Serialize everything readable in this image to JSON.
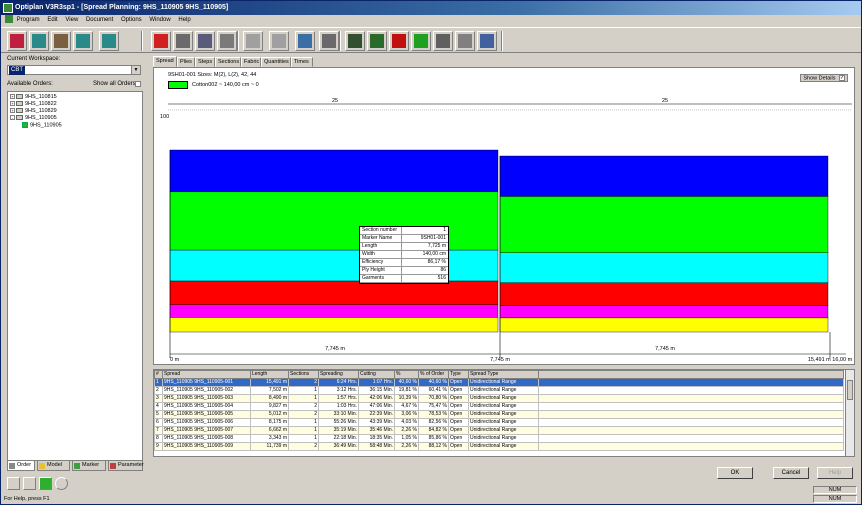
{
  "window": {
    "title": "Optiplan V3R3sp1 - [Spread Planning: 9HS_110905 9HS_110905]"
  },
  "menu": [
    "Program",
    "Edit",
    "View",
    "Document",
    "Options",
    "Window",
    "Help"
  ],
  "toolbar_icons": [
    "planning-icon",
    "marker-icon",
    "order-icon",
    "spread-icon",
    "cut-icon",
    "save-icon",
    "print-preview-icon",
    "edit-icon",
    "columns-icon",
    "move-icon",
    "hand-icon",
    "report-icon",
    "mail-icon",
    "marker-tool-icon",
    "marker-tool-2-icon",
    "trash-red-icon",
    "trash-green-icon",
    "trash-gray-icon",
    "print-icon",
    "zoom-icon"
  ],
  "left": {
    "workspace_label": "Current Workspace:",
    "workspace_value": "CBT",
    "orders_label": "Available Orders:",
    "show_all_label": "Show all Orders",
    "tree": [
      {
        "label": "9HS_110815",
        "level": 0,
        "expander": "+"
      },
      {
        "label": "9HS_110822",
        "level": 0,
        "expander": "+"
      },
      {
        "label": "9HS_110829",
        "level": 0,
        "expander": "+"
      },
      {
        "label": "9HS_110905",
        "level": 0,
        "expander": "-"
      },
      {
        "label": "9HS_110905",
        "level": 1,
        "expander": ""
      }
    ],
    "tabs": [
      "Order",
      "Model",
      "Marker",
      "Parameter"
    ]
  },
  "main": {
    "tabs": [
      "Spread",
      "Plies",
      "Steps",
      "Sections",
      "Fabric",
      "Quantities",
      "Times"
    ],
    "active_tab": "Spread",
    "header_line": "9SH01-001 Sizes: M(2), L(2), 42, 44",
    "fabric_line": "Cotton002 ~ 140,00 cm ~ 0",
    "fabric_color": "#00ff00",
    "show_details": "Show Details",
    "show_details_checked": "✓"
  },
  "chart_data": {
    "type": "spread-plan",
    "y_label": "100",
    "sections": [
      {
        "plies": "25",
        "length_label": "7,745 m",
        "layers": [
          "#0000ff",
          "#00ff00",
          "#00ffff",
          "#ff0000",
          "#ff00ff",
          "#ffff00"
        ],
        "layer_heights": [
          0.23,
          0.32,
          0.17,
          0.13,
          0.07,
          0.08
        ]
      },
      {
        "plies": "25",
        "length_label": "7,745 m",
        "layers": [
          "#0000ff",
          "#00ff00",
          "#00ffff",
          "#ff0000",
          "#ff00ff",
          "#ffff00"
        ],
        "layer_heights": [
          0.23,
          0.32,
          0.17,
          0.13,
          0.07,
          0.08
        ]
      }
    ],
    "ruler": [
      "0 m",
      "7,745 m",
      "15,491 m 16,00 m"
    ]
  },
  "info_box": [
    {
      "k": "Section number",
      "v": "1"
    },
    {
      "k": "Marker Name",
      "v": "9SH01-001"
    },
    {
      "k": "Length",
      "v": "7,725 m"
    },
    {
      "k": "Width",
      "v": "140,00 cm"
    },
    {
      "k": "Efficiency",
      "v": "86,17 %"
    },
    {
      "k": "Ply Height",
      "v": "86"
    },
    {
      "k": "Garments",
      "v": "516"
    }
  ],
  "table": {
    "headers": [
      "#",
      "Spread",
      "Length",
      "Sections",
      "Spreading",
      "Cutting",
      "%",
      "% of Order",
      "Type",
      "Spread Type"
    ],
    "rows": [
      [
        "1",
        "9HS_110905 9HS_110905-001",
        "15,491 m",
        "2",
        "6:24 Hrs.",
        "1:07 Hrs.",
        "40,60 %",
        "40,60 %",
        "Open",
        "Unidirectional Range"
      ],
      [
        "2",
        "9HS_110905 9HS_110905-002",
        "7,502 m",
        "1",
        "3:12 Hrs.",
        "36:15 Min.",
        "19,81 %",
        "60,41 %",
        "Open",
        "Unidirectional Range"
      ],
      [
        "3",
        "9HS_110905 9HS_110905-003",
        "8,490 m",
        "1",
        "1:57 Hrs.",
        "42:06 Min.",
        "10,39 %",
        "70,80 %",
        "Open",
        "Unidirectional Range"
      ],
      [
        "4",
        "9HS_110905 9HS_110905-004",
        "9,827 m",
        "2",
        "1:03 Hrs.",
        "47:06 Min.",
        "4,67 %",
        "75,47 %",
        "Open",
        "Unidirectional Range"
      ],
      [
        "5",
        "9HS_110905 9HS_110905-005",
        "5,012 m",
        "2",
        "33:10 Min.",
        "22:39 Min.",
        "3,06 %",
        "78,53 %",
        "Open",
        "Unidirectional Range"
      ],
      [
        "6",
        "9HS_110905 9HS_110905-006",
        "8,175 m",
        "1",
        "55:26 Min.",
        "43:39 Min.",
        "4,03 %",
        "82,56 %",
        "Open",
        "Unidirectional Range"
      ],
      [
        "7",
        "9HS_110905 9HS_110905-007",
        "6,662 m",
        "1",
        "35:19 Min.",
        "35:46 Min.",
        "2,26 %",
        "84,82 %",
        "Open",
        "Unidirectional Range"
      ],
      [
        "8",
        "9HS_110905 9HS_110905-008",
        "3,343 m",
        "1",
        "22:18 Min.",
        "18:35 Min.",
        "1,05 %",
        "85,86 %",
        "Open",
        "Unidirectional Range"
      ],
      [
        "9",
        "9HS_110905 9HS_110905-009",
        "11,739 m",
        "2",
        "36:49 Min.",
        "58:48 Min.",
        "2,26 %",
        "88,12 %",
        "Open",
        "Unidirectional Range"
      ]
    ]
  },
  "buttons": {
    "ok": "OK",
    "cancel": "Cancel",
    "help": "Help"
  },
  "status": {
    "help_text": "For Help, press F1",
    "num1": "NUM",
    "num2": "NUM"
  }
}
